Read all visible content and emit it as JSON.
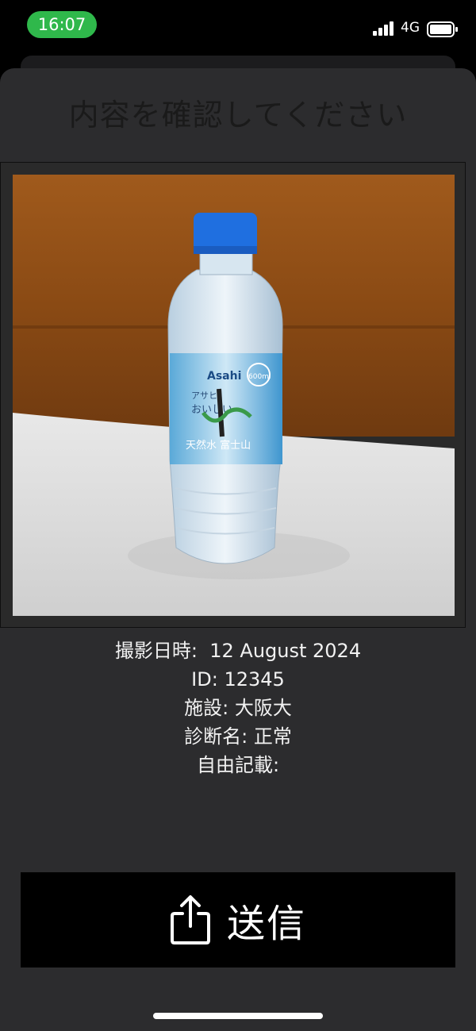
{
  "status_bar": {
    "time": "16:07",
    "network": "4G",
    "icons": [
      "signal-icon",
      "battery-icon"
    ]
  },
  "dialog": {
    "title": "内容を確認してください"
  },
  "photo": {
    "description_icon": "photo-image"
  },
  "info": {
    "date_label": "撮影日時:",
    "date_value": "12 August 2024",
    "id_label": "ID:",
    "id_value": "12345",
    "facility_label": "施設:",
    "facility_value": "大阪大",
    "diagnosis_label": "診断名:",
    "diagnosis_value": "正常",
    "notes_label": "自由記載:",
    "notes_value": ""
  },
  "actions": {
    "send_label": "送信",
    "send_icon": "share-icon"
  },
  "colors": {
    "time_pill": "#2fb84b",
    "sheet_bg": "#2c2c2e",
    "button_bg": "#000000",
    "text": "#f2f2f2"
  }
}
